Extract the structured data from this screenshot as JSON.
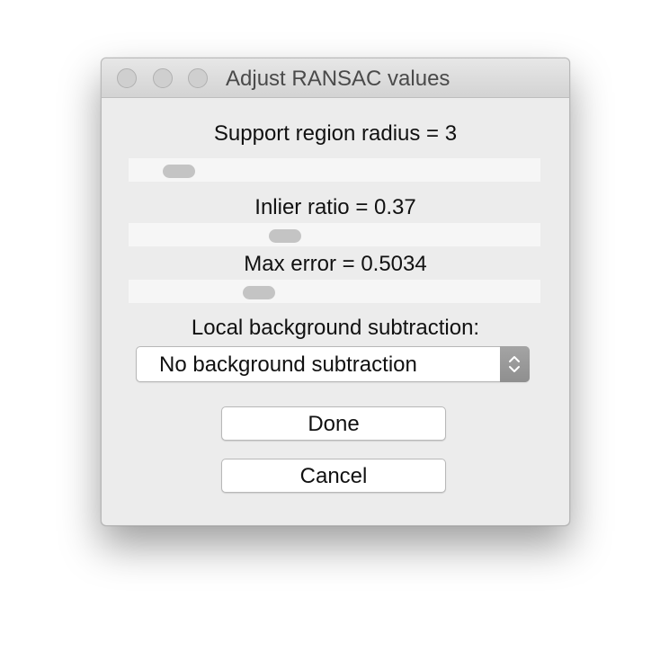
{
  "window": {
    "title": "Adjust RANSAC values"
  },
  "controls": {
    "support_region": {
      "label": "Support region radius = 3",
      "slider_fraction": 0.09
    },
    "inlier_ratio": {
      "label": "Inlier ratio = 0.37",
      "slider_fraction": 0.37
    },
    "max_error": {
      "label": "Max error = 0.5034",
      "slider_fraction": 0.3
    },
    "background": {
      "label": "Local background subtraction:",
      "selected": "No background subtraction"
    }
  },
  "buttons": {
    "done": "Done",
    "cancel": "Cancel"
  },
  "icons": {
    "window_controls": [
      "close-icon",
      "minimize-icon",
      "zoom-icon"
    ],
    "dropdown": "updown-chevron-icon"
  },
  "colors": {
    "window_bg": "#ececec",
    "track": "#f6f6f6",
    "thumb": "#c4c4c4",
    "traffic_light_inactive": "#cfcfcf",
    "stepper": "#9a9a9a"
  }
}
